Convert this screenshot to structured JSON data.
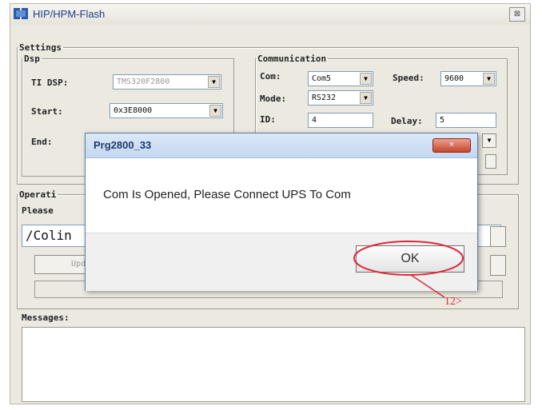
{
  "window": {
    "title": "HIP/HPM-Flash",
    "close": "⊠"
  },
  "settings": {
    "legend": "Settings",
    "dsp": {
      "legend": "Dsp",
      "ti_dsp_label": "TI DSP:",
      "ti_dsp_value": "TMS320F2800",
      "start_label": "Start:",
      "start_value": "0x3E8000",
      "end_label": "End:"
    },
    "communication": {
      "legend": "Communication",
      "com_label": "Com:",
      "com_value": "Com5",
      "speed_label": "Speed:",
      "speed_value": "9600",
      "mode_label": "Mode:",
      "mode_value": "RS232",
      "id_label": "ID:",
      "id_value": "4",
      "delay_label": "Delay:",
      "delay_value": "5"
    }
  },
  "operation": {
    "legend": "Operati",
    "prompt": "Please",
    "path_value": "/Colin",
    "update_label": "Upd"
  },
  "messages": {
    "label": "Messages:"
  },
  "dialog": {
    "title": "Prg2800_33",
    "close": "×",
    "message": "Com Is Opened, Please Connect UPS To Com",
    "ok_label": "OK"
  },
  "annotation": {
    "text": "12>",
    "color": "#e0283a"
  },
  "colors": {
    "dialog_title": "#1e3c6e",
    "window_title": "#1f3d8f"
  }
}
